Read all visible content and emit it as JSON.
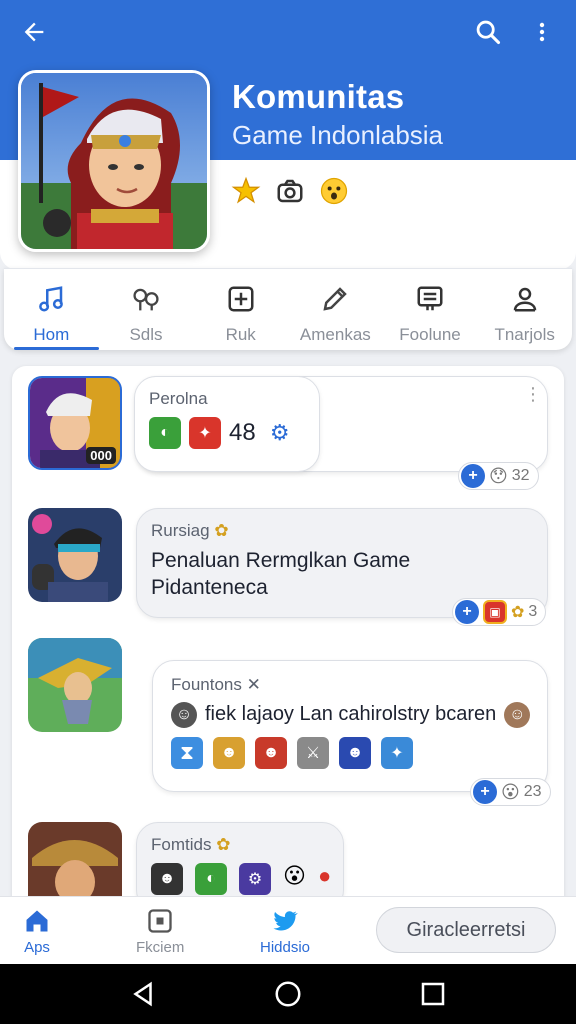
{
  "header": {
    "title": "Komunitas",
    "subtitle": "Game Indonlabsia",
    "emojis": [
      "★",
      "📷",
      "😮"
    ]
  },
  "tabs": [
    {
      "label": "Hom",
      "icon": "music-note-icon",
      "active": true
    },
    {
      "label": "Sdls",
      "icon": "gears-icon",
      "active": false
    },
    {
      "label": "Ruk",
      "icon": "plus-square-icon",
      "active": false
    },
    {
      "label": "Amenkas",
      "icon": "pencil-icon",
      "active": false
    },
    {
      "label": "Foolune",
      "icon": "doc-icon",
      "active": false
    },
    {
      "label": "Tnarjols",
      "icon": "person-icon",
      "active": false
    }
  ],
  "posts": [
    {
      "name": "Perolna",
      "count": "48",
      "badge": "000",
      "reactions": "32"
    },
    {
      "name": "Rursiag",
      "text_line1": "Penaluan Rermglkan Game",
      "text_line2": "Pidantenecа",
      "reactions": "3"
    },
    {
      "name": "Fountons",
      "text": "fiek lajaoy Lan cahirolstry bcaren",
      "reactions": "23"
    },
    {
      "name": "Fomtids"
    }
  ],
  "bottom_nav": [
    {
      "label": "Aps",
      "icon": "home-icon",
      "active": true
    },
    {
      "label": "Fkciem",
      "icon": "square-icon",
      "active": false
    },
    {
      "label": "Hiddsio",
      "icon": "bird-icon",
      "active": true
    }
  ],
  "pill_label": "Giracleerretsi",
  "colors": {
    "accent": "#2f6fd6",
    "text": "#1d2230",
    "muted": "#8a8f98"
  }
}
